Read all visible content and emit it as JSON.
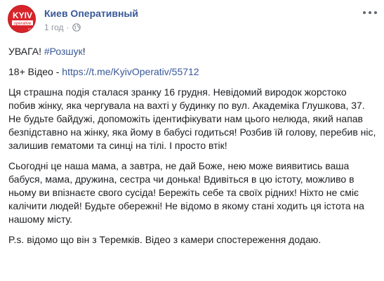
{
  "post": {
    "page_name": "Киев Оперативный",
    "time": "1 год",
    "separator": "·",
    "visibility_icon": "globe-icon",
    "more_icon": "more-horizontal-icon",
    "avatar": {
      "logo_text": "KYIV",
      "logo_subtext": "operative",
      "logo_suffix": "ua",
      "brand_color": "#d8232a"
    },
    "line1_prefix": "УВАГА! ",
    "line1_hashtag": "#Розшук",
    "line1_suffix": "!",
    "line2_prefix": "18+ Відео - ",
    "line2_link": "https://t.me/KyivOperativ/55712",
    "paragraph1": "Ця страшна подія сталася зранку 16 грудня. Невідомий виродок жорстоко побив жінку, яка чергувала на вахті у будинку по вул. Академіка Глушкова, 37.",
    "paragraph2": "Не будьте байдужі, допоможіть ідентифікувати нам цього нелюда, який напав безпідставно на жінку, яка йому в бабусі годиться! Розбив їй голову, перебив ніс, залишив гематоми та синці на тілі. І просто втік!",
    "paragraph3": "Сьогодні це наша мама, а завтра, не дай Боже, нею може виявитись ваша бабуся, мама, дружина, сестра чи донька! Вдивіться в цю істоту, можливо в ньому ви впізнаєте свого сусіда! Бережіть себе та своїх рідних! Ніхто не сміє калічити людей! Будьте обережні! Не відомо в якому стані ходить ця істота на нашому місту.",
    "paragraph4": "P.s. відомо що він з Теремків. Відео з камери спостереження додаю.",
    "colors": {
      "link": "#385898",
      "text": "#1c1e21",
      "meta": "#90949c"
    }
  }
}
